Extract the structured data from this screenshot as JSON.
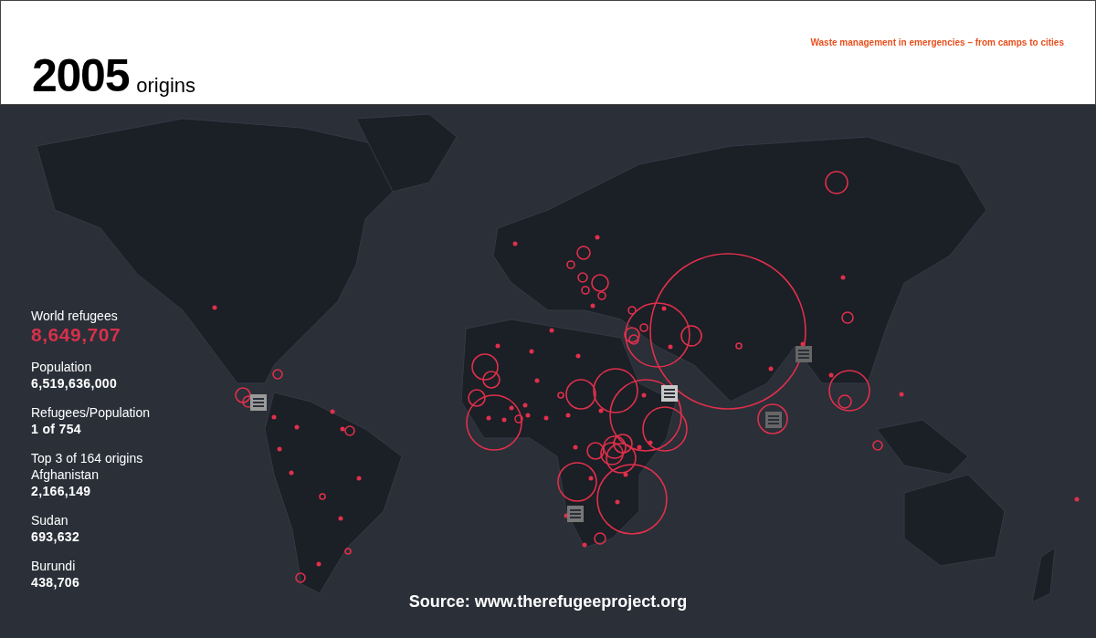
{
  "header": {
    "year": "2005",
    "subtitle": "origins",
    "tagline": "Waste management in emergencies – from camps to cities"
  },
  "stats": [
    {
      "label": "World refugees",
      "value": "8,649,707",
      "kind": "highlight"
    },
    {
      "label": "Population",
      "value": "6,519,636,000",
      "kind": "plain"
    },
    {
      "label": "Refugees/Population",
      "value": "1 of 754",
      "kind": "plain"
    }
  ],
  "top_origins": {
    "heading": "Top 3 of 164 origins",
    "items": [
      {
        "name": "Afghanistan",
        "value": "2,166,149"
      },
      {
        "name": "Sudan",
        "value": "693,632"
      },
      {
        "name": "Burundi",
        "value": "438,706"
      }
    ]
  },
  "source": "Source: www.therefugeeproject.org"
}
